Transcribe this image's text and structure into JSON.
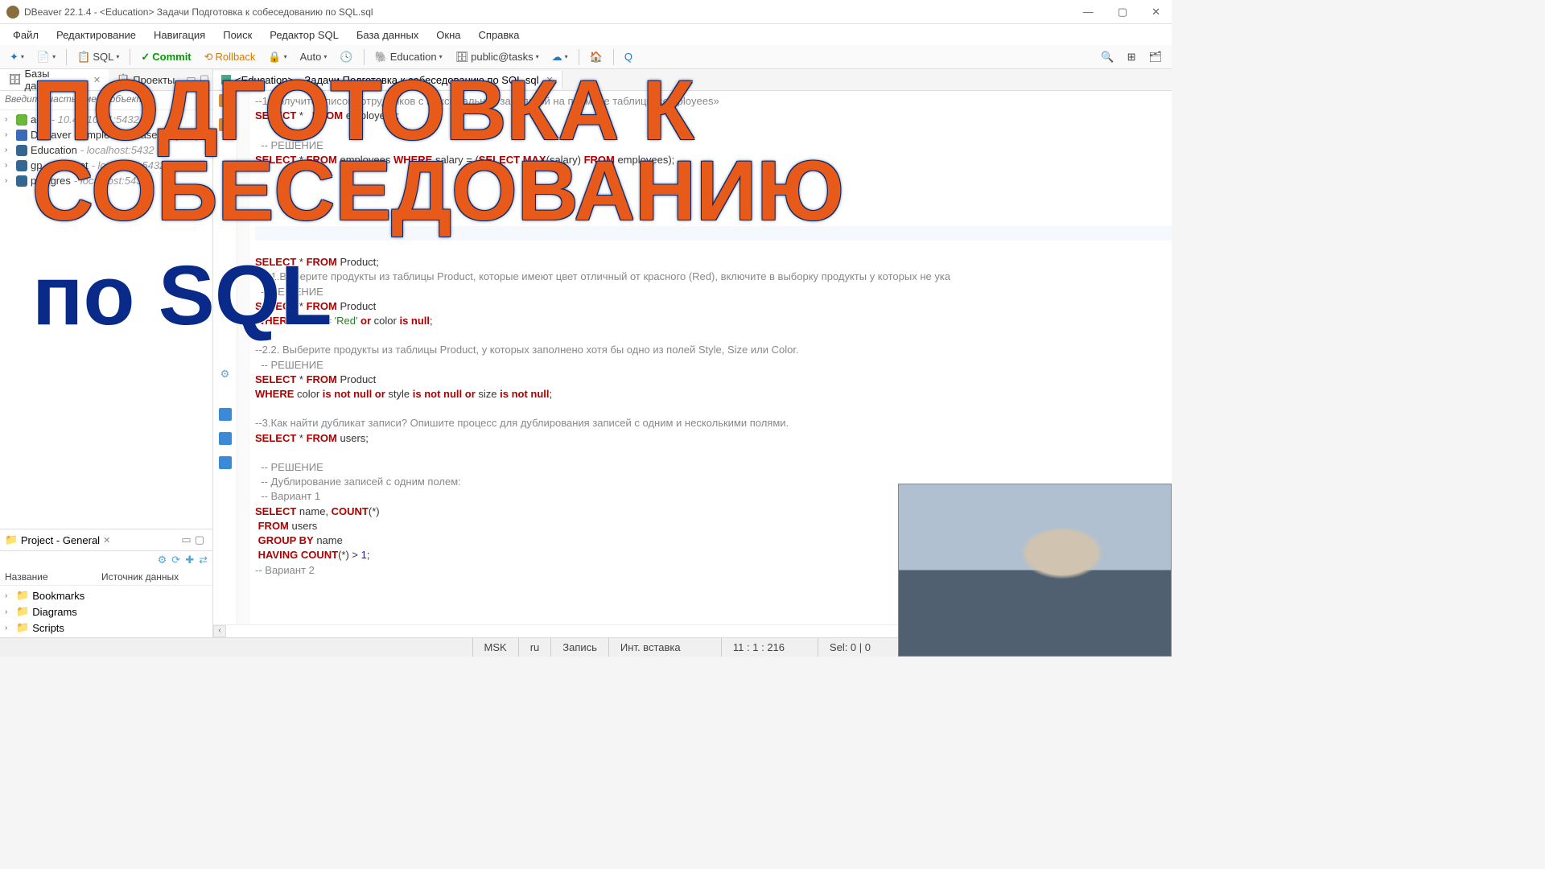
{
  "window": {
    "title": "DBeaver 22.1.4 - <Education> Задачи Подготовка к собеседованию по SQL.sql"
  },
  "menubar": [
    "Файл",
    "Редактирование",
    "Навигация",
    "Поиск",
    "Редактор SQL",
    "База данных",
    "Окна",
    "Справка"
  ],
  "toolbar": {
    "sql": "SQL",
    "commit": "Commit",
    "rollback": "Rollback",
    "auto": "Auto",
    "db": "Education",
    "schema": "public@tasks"
  },
  "left_panel": {
    "tab1": "Базы данных",
    "tab2": "Проекты",
    "search_placeholder": "Введите часть имени объекта",
    "tree": [
      {
        "label": "adb",
        "host": "- 10.40.10.51:5432",
        "icon": "db"
      },
      {
        "label": "DBeaver Sample Database (SQLite)",
        "host": "",
        "icon": "db2"
      },
      {
        "label": "Education",
        "host": "- localhost:5432",
        "icon": "pg"
      },
      {
        "label": "gp_superset",
        "host": "- localhost:5432",
        "icon": "pg"
      },
      {
        "label": "postgres",
        "host": "- localhost:5432",
        "icon": "pg"
      }
    ]
  },
  "project_panel": {
    "title": "Project - General",
    "col1": "Название",
    "col2": "Источник данных",
    "items": [
      "Bookmarks",
      "Diagrams",
      "Scripts"
    ]
  },
  "editor": {
    "tab_prefix": "<Education>",
    "tab_name": "Задачи Подготовка к собеседованию по SQL.sql"
  },
  "code": {
    "l1_cmt": "--1.Получите список сотрудников с максимальной зарплатой на примере таблицы «employees»",
    "l2": {
      "select": "SELECT",
      "star": " *   ",
      "from": "FROM",
      "rest": " employees;"
    },
    "l3": "",
    "l4_cmt": "  -- РЕШЕНИЕ",
    "l5": "SELECT * FROM employees WHERE salary = (SELECT MAX(salary) FROM employees);",
    "empty": "",
    "l12": {
      "select": "SELECT",
      "star": " * ",
      "from": "FROM",
      "rest": " Product;"
    },
    "l13_cmt": "--2.1.Выберите продукты из таблицы Product, которые имеют цвет отличный от красного (Red), включите в выборку продукты у которых не ука",
    "l14_cmt": "  -- РЕШЕНИЕ",
    "l15": {
      "select": "SELECT",
      "star": " * ",
      "from": "FROM",
      "rest": " Product"
    },
    "l16": {
      "where": "WHERE",
      "rest1": " color != ",
      "str": "'Red'",
      "or": " or",
      "rest2": " color ",
      "is": "is null",
      "semi": ";"
    },
    "l18_cmt": "--2.2. Выберите продукты из таблицы Product, у которых заполнено хотя бы одно из полей Style, Size или Color.",
    "l19_cmt": "  -- РЕШЕНИЕ",
    "l20": {
      "select": "SELECT",
      "star": " * ",
      "from": "FROM",
      "rest": " Product"
    },
    "l21": {
      "where": "WHERE",
      "r1": " color ",
      "k1": "is not null or",
      "r2": " style ",
      "k2": "is not null or",
      "r3": " size ",
      "k3": "is not null",
      "semi": ";"
    },
    "l23_cmt": "--3.Как найти дубликат записи? Опишите процесс для дублирования записей с одним и несколькими полями.",
    "l24": {
      "select": "SELECT",
      "star": " * ",
      "from": "FROM",
      "rest": " users;"
    },
    "l26_cmt": "  -- РЕШЕНИЕ",
    "l27_cmt": "  -- Дублирование записей с одним полем:",
    "l28_cmt": "  -- Вариант 1",
    "l29": {
      "select": "SELECT",
      "r1": " name, ",
      "count": "COUNT",
      "r2": "(*)"
    },
    "l30": {
      "from": " FROM",
      "rest": " users"
    },
    "l31": {
      "gb": " GROUP BY",
      "rest": " name"
    },
    "l32": {
      "hav": " HAVING",
      "count": " COUNT",
      "r1": "(*) > ",
      "num": "1",
      "semi": ";"
    },
    "l33_cmt": "-- Вариант 2"
  },
  "statusbar": {
    "tz": "MSK",
    "lang": "ru",
    "mode1": "Запись",
    "mode2": "Инт. вставка",
    "pos": "11 : 1 : 216",
    "sel": "Sel: 0 | 0"
  },
  "overlay": {
    "l1": "ПОДГОТОВКА К",
    "l2": "СОБЕСЕДОВАНИЮ",
    "l3": "по SQL"
  }
}
